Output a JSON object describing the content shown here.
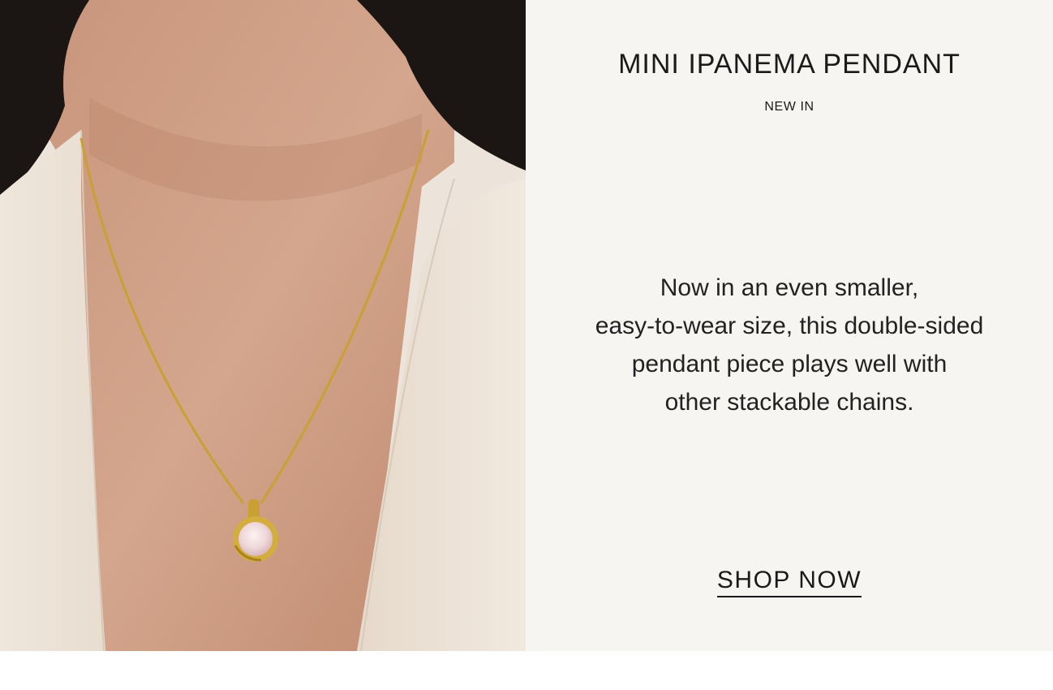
{
  "product": {
    "title": "MINI IPANEMA PENDANT",
    "tag": "NEW IN",
    "description_lines": [
      "Now in an even smaller,",
      "easy-to-wear size, this double-sided",
      "pendant piece plays well with",
      "other stackable chains."
    ],
    "cta_label": "SHOP NOW"
  },
  "image": {
    "subject": "model-wearing-gold-pendant-necklace"
  },
  "colors": {
    "panel_background": "#f7f5f2",
    "text": "#1a1a1a",
    "gold": "#c9a033",
    "stone": "#f3dede"
  }
}
